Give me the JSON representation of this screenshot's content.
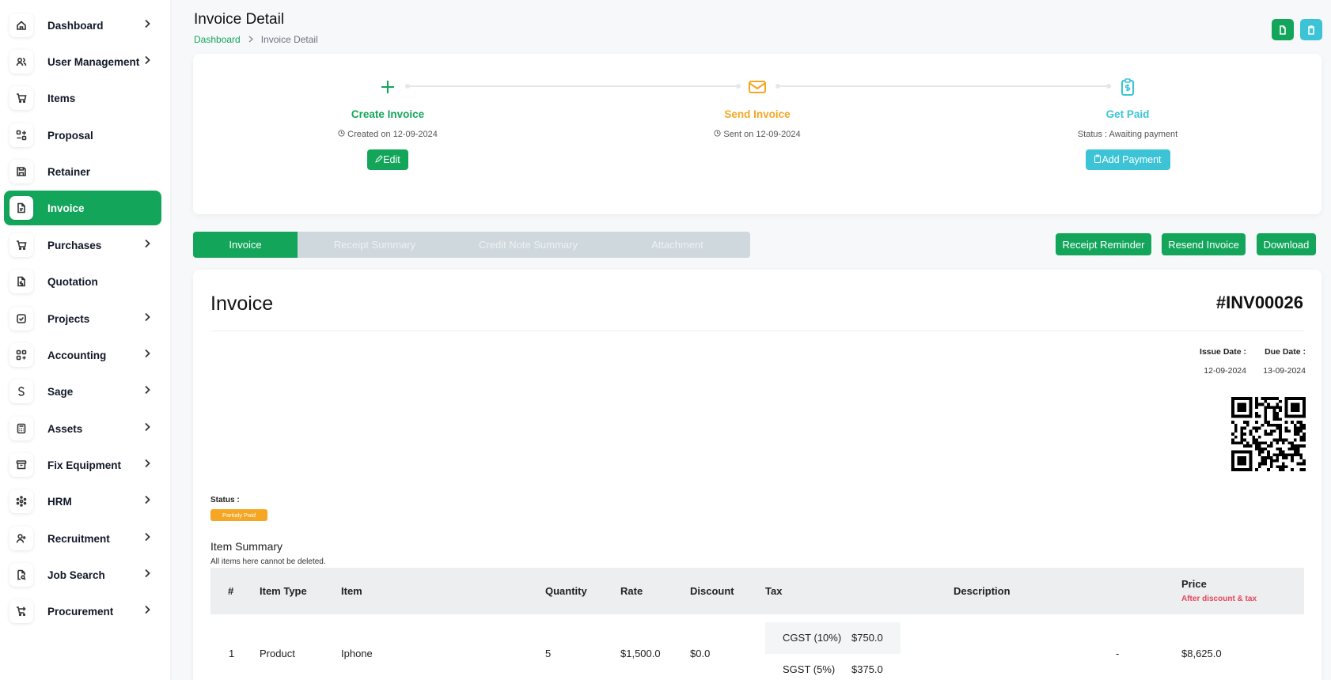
{
  "sidebar": {
    "items": [
      {
        "label": "Dashboard",
        "icon": "home-icon",
        "chevron": true
      },
      {
        "label": "User Management",
        "icon": "users-icon",
        "chevron": true
      },
      {
        "label": "Items",
        "icon": "cart-icon",
        "chevron": false
      },
      {
        "label": "Proposal",
        "icon": "proposal-icon",
        "chevron": false
      },
      {
        "label": "Retainer",
        "icon": "save-icon",
        "chevron": false
      },
      {
        "label": "Invoice",
        "icon": "file-icon",
        "chevron": false,
        "active": true
      },
      {
        "label": "Purchases",
        "icon": "cart-icon",
        "chevron": true
      },
      {
        "label": "Quotation",
        "icon": "file-dollar-icon",
        "chevron": false
      },
      {
        "label": "Projects",
        "icon": "checkbox-icon",
        "chevron": true
      },
      {
        "label": "Accounting",
        "icon": "grid-plus-icon",
        "chevron": true
      },
      {
        "label": "Sage",
        "icon": "s-letter-icon",
        "chevron": true
      },
      {
        "label": "Assets",
        "icon": "calculator-icon",
        "chevron": true
      },
      {
        "label": "Fix Equipment",
        "icon": "archive-icon",
        "chevron": true
      },
      {
        "label": "HRM",
        "icon": "network-icon",
        "chevron": true
      },
      {
        "label": "Recruitment",
        "icon": "user-plus-icon",
        "chevron": true
      },
      {
        "label": "Job Search",
        "icon": "file-search-icon",
        "chevron": true
      },
      {
        "label": "Procurement",
        "icon": "cart-arrow-icon",
        "chevron": true
      }
    ]
  },
  "header": {
    "title": "Invoice Detail",
    "breadcrumb": {
      "link": "Dashboard",
      "current": "Invoice Detail"
    }
  },
  "steps": [
    {
      "title": "Create Invoice",
      "sub": "Created on 12-09-2024",
      "button": "Edit",
      "color": "#13a65a"
    },
    {
      "title": "Send Invoice",
      "sub": "Sent on 12-09-2024",
      "color": "#f5a623"
    },
    {
      "title": "Get Paid",
      "sub": "Status : Awaiting payment",
      "button": "Add Payment",
      "color": "#3cc4d6"
    }
  ],
  "tabs": [
    "Invoice",
    "Receipt Summary",
    "Credit Note Summary",
    "Attachment"
  ],
  "actions": {
    "receipt_reminder": "Receipt Reminder",
    "resend": "Resend Invoice",
    "download": "Download"
  },
  "invoice": {
    "title": "Invoice",
    "number": "#INV00026",
    "issue_label": "Issue Date :",
    "issue_date": "12-09-2024",
    "due_label": "Due Date :",
    "due_date": "13-09-2024",
    "status_label": "Status :",
    "status": "Partialy Paid"
  },
  "summary": {
    "title": "Item Summary",
    "note": "All items here cannot be deleted.",
    "columns": {
      "num": "#",
      "type": "Item Type",
      "item": "Item",
      "qty": "Quantity",
      "rate": "Rate",
      "discount": "Discount",
      "tax": "Tax",
      "description": "Description",
      "price": "Price",
      "price_sub": "After discount & tax"
    },
    "rows": [
      {
        "num": "1",
        "type": "Product",
        "item": "Iphone",
        "qty": "5",
        "rate": "$1,500.0",
        "discount": "$0.0",
        "taxes": [
          {
            "name": "CGST (10%)",
            "amount": "$750.0"
          },
          {
            "name": "SGST (5%)",
            "amount": "$375.0"
          }
        ],
        "description": "-",
        "price": "$8,625.0"
      }
    ]
  }
}
